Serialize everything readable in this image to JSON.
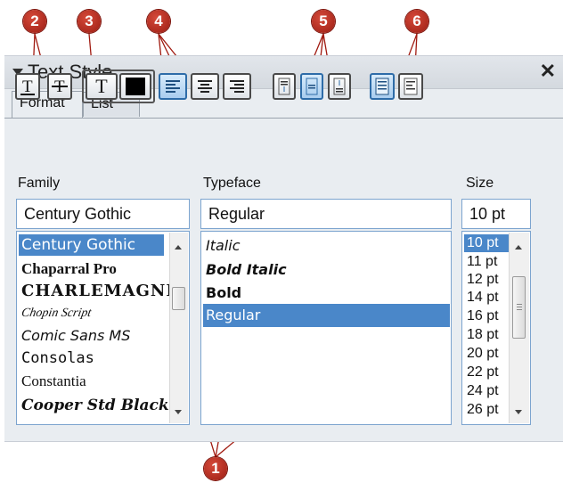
{
  "panel": {
    "title": "Text Style",
    "close_glyph": "✕",
    "tabs": [
      {
        "label": "Format"
      },
      {
        "label": "List"
      }
    ]
  },
  "toolbar": {
    "icons": [
      "underline-icon",
      "strikethrough-icon",
      "text-color-icon",
      "fill-color-swatch",
      "align-left-icon",
      "align-center-icon",
      "align-right-icon",
      "valign-top-icon",
      "valign-middle-icon",
      "valign-bottom-icon",
      "text-wrap-icon",
      "text-box-icon"
    ],
    "text_glyph": "T",
    "text_color": "#000000"
  },
  "family": {
    "label": "Family",
    "value": "Century Gothic",
    "items": [
      "Century Gothic",
      "Chaparral Pro",
      "CHARLEMAGNE",
      "Chopin Script",
      "Comic Sans MS",
      "Consolas",
      "Constantia",
      "Cooper Std Black"
    ]
  },
  "typeface": {
    "label": "Typeface",
    "value": "Regular",
    "items": [
      "Italic",
      "Bold Italic",
      "Bold",
      "Regular"
    ]
  },
  "size": {
    "label": "Size",
    "value": "10 pt",
    "items": [
      "10 pt",
      "11 pt",
      "12 pt",
      "14 pt",
      "16 pt",
      "18 pt",
      "20 pt",
      "22 pt",
      "24 pt",
      "26 pt"
    ]
  },
  "callouts": [
    "1",
    "2",
    "3",
    "4",
    "5",
    "6"
  ],
  "colors": {
    "selection": "#4a87c9",
    "callout": "#b3261a",
    "active_button": "#a9cdef"
  }
}
